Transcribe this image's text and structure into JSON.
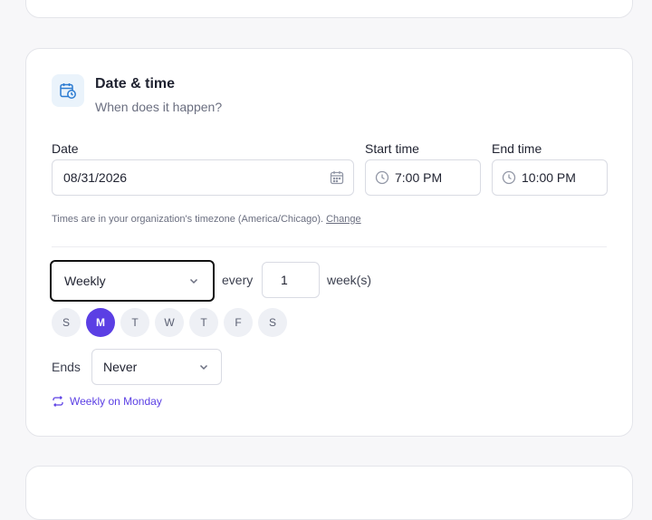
{
  "section": {
    "title": "Date & time",
    "subtitle": "When does it happen?",
    "icon": "calendar-clock-icon"
  },
  "date": {
    "label": "Date",
    "value": "08/31/2026",
    "icon": "calendar-icon"
  },
  "start_time": {
    "label": "Start time",
    "value": "7:00 PM",
    "icon": "clock-icon"
  },
  "end_time": {
    "label": "End time",
    "value": "10:00 PM",
    "icon": "clock-icon"
  },
  "timezone_note": {
    "text": "Times are in your organization's timezone (America/Chicago).",
    "link": "Change"
  },
  "recurrence": {
    "frequency": "Weekly",
    "every_label": "every",
    "interval": "1",
    "unit_label": "week(s)",
    "days": [
      {
        "label": "S",
        "active": false
      },
      {
        "label": "M",
        "active": true
      },
      {
        "label": "T",
        "active": false
      },
      {
        "label": "W",
        "active": false
      },
      {
        "label": "T",
        "active": false
      },
      {
        "label": "F",
        "active": false
      },
      {
        "label": "S",
        "active": false
      }
    ],
    "ends_label": "Ends",
    "ends_value": "Never",
    "summary": "Weekly on Monday",
    "summary_icon": "repeat-icon"
  },
  "colors": {
    "accent": "#5b3fe4",
    "icon_blue": "#2b7bd1",
    "border": "#d9dbe3"
  }
}
